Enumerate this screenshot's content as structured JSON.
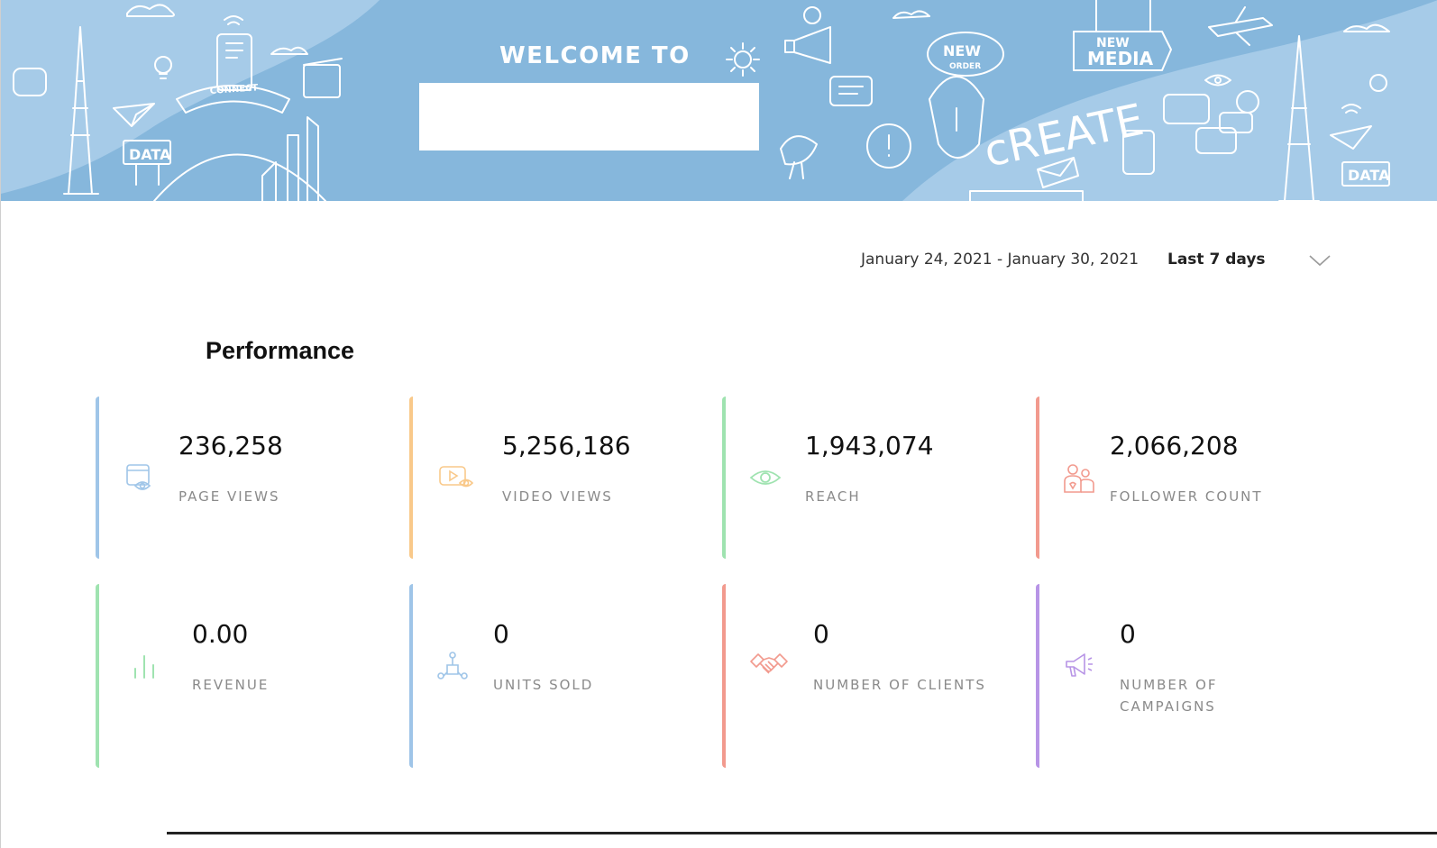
{
  "banner": {
    "welcome_text": "WELCOME TO",
    "doodle_words": {
      "data_left": "DATA",
      "data_right": "DATA",
      "connect": "CONNECT",
      "new_order": "NEW",
      "order": "ORDER",
      "new_media_1": "NEW",
      "new_media_2": "MEDIA",
      "create": "cREATE"
    },
    "colors": {
      "background": "#86b7dc",
      "accent": "#a6cbe8"
    }
  },
  "filters": {
    "date_range": "January 24, 2021 - January 30, 2021",
    "range_selected": "Last 7 days",
    "range_icon": "chevron-down-icon"
  },
  "performance": {
    "title": "Performance",
    "cards": [
      {
        "value": "236,258",
        "label": "PAGE VIEWS",
        "icon": "page-views-icon",
        "color": "#9fc5e8"
      },
      {
        "value": "5,256,186",
        "label": "VIDEO VIEWS",
        "icon": "video-views-icon",
        "color": "#f9c98a"
      },
      {
        "value": "1,943,074",
        "label": "REACH",
        "icon": "eye-icon",
        "color": "#9fe3b0"
      },
      {
        "value": "2,066,208",
        "label": "FOLLOWER COUNT",
        "icon": "followers-icon",
        "color": "#f29a8e"
      },
      {
        "value": "0.00",
        "label": "REVENUE",
        "icon": "bar-chart-icon",
        "color": "#9fe3b0"
      },
      {
        "value": "0",
        "label": "UNITS SOLD",
        "icon": "network-icon",
        "color": "#9fc5e8"
      },
      {
        "value": "0",
        "label": "NUMBER OF CLIENTS",
        "icon": "handshake-icon",
        "color": "#f29a8e"
      },
      {
        "value": "0",
        "label": "NUMBER OF CAMPAIGNS",
        "icon": "megaphone-icon",
        "color": "#b794e6"
      }
    ]
  }
}
